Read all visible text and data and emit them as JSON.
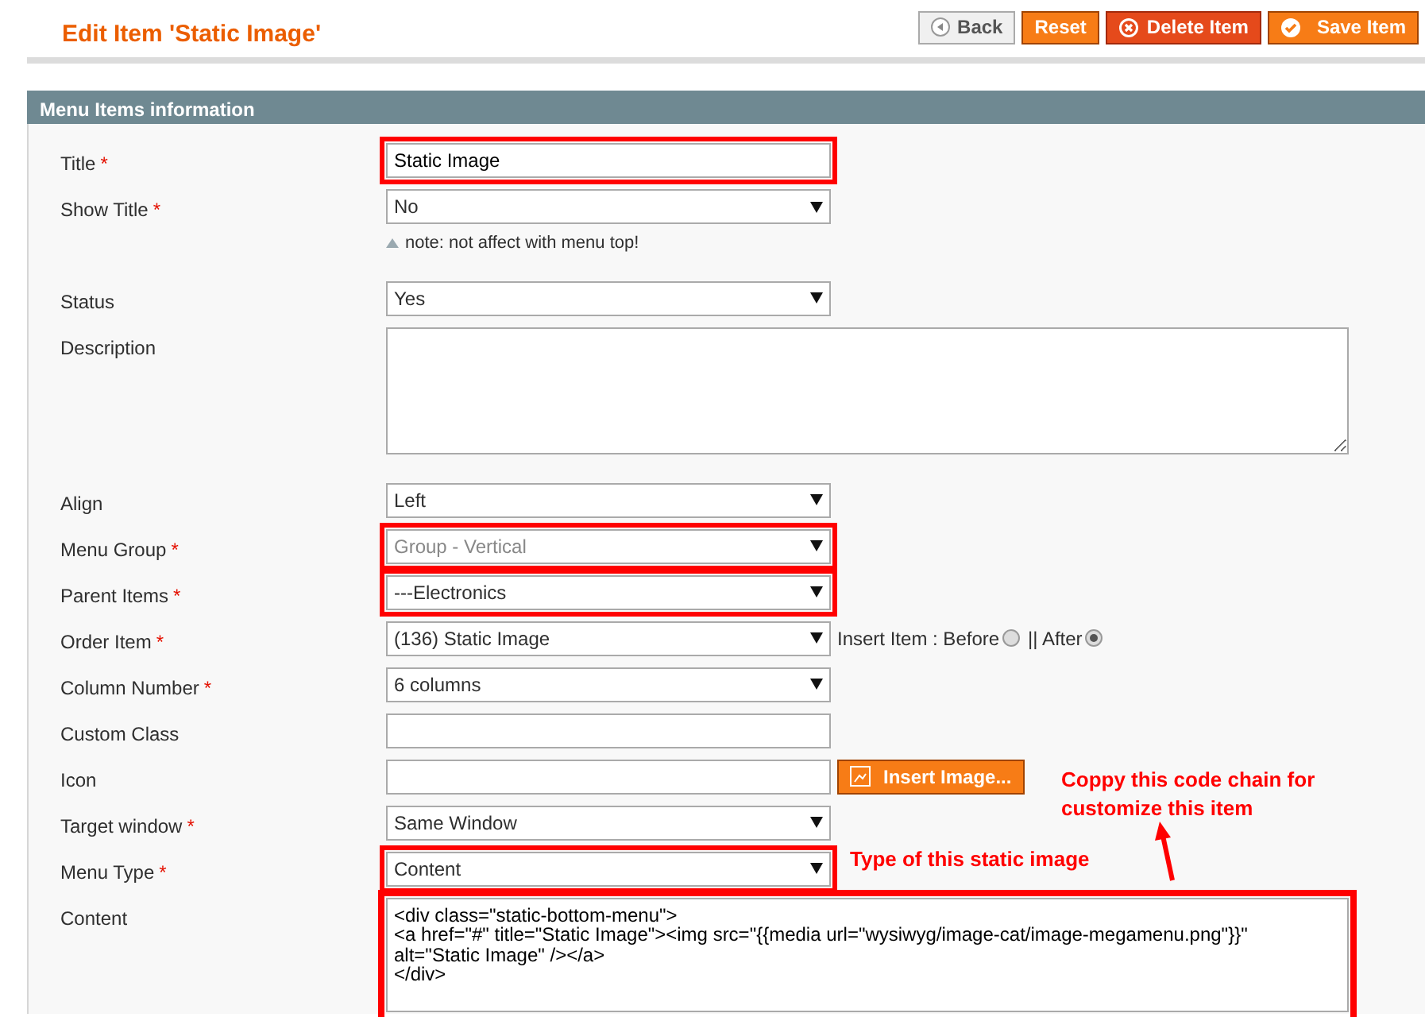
{
  "header": {
    "title": "Edit Item 'Static Image'"
  },
  "buttons": [
    {
      "label": "Back",
      "kind": "back"
    },
    {
      "label": "Reset",
      "kind": "reset"
    },
    {
      "label": "Delete Item",
      "kind": "delete"
    },
    {
      "label": "Save Item",
      "kind": "save"
    }
  ],
  "section": {
    "title": "Menu Items information"
  },
  "fields": [
    {
      "label": "Title",
      "required_mark": "*",
      "kind": "text",
      "value": "Static Image",
      "highlighted": true
    },
    {
      "label": "Show Title",
      "required_mark": "*",
      "kind": "select",
      "value": "No",
      "highlighted": false,
      "note": "note: not affect with menu top!"
    },
    {
      "label": "Status",
      "kind": "select",
      "value": "Yes",
      "highlighted": false
    },
    {
      "label": "Description",
      "kind": "textarea",
      "highlighted": false
    },
    {
      "label": "Align",
      "kind": "select",
      "value": "Left",
      "highlighted": false
    },
    {
      "label": "Menu Group",
      "required_mark": "*",
      "kind": "select",
      "value": "Group - Vertical",
      "highlighted": true,
      "disabled": true
    },
    {
      "label": "Parent Items",
      "required_mark": "*",
      "kind": "select",
      "value": "---Electronics",
      "highlighted": true
    },
    {
      "label": "Order Item",
      "required_mark": "*",
      "kind": "order",
      "value": "(136) Static Image",
      "highlighted": false,
      "radios": [
        {
          "label": "Insert Item : Before",
          "selected": false
        },
        {
          "label": "|| After",
          "selected": true
        }
      ]
    },
    {
      "label": "Column Number",
      "required_mark": "*",
      "kind": "select",
      "value": "6 columns",
      "highlighted": false
    },
    {
      "label": "Custom Class",
      "kind": "text",
      "highlighted": false
    },
    {
      "label": "Icon",
      "kind": "icon",
      "highlighted": false,
      "button": "Insert Image..."
    },
    {
      "label": "Target window",
      "required_mark": "*",
      "kind": "select",
      "value": "Same Window",
      "highlighted": false
    },
    {
      "label": "Menu Type",
      "required_mark": "*",
      "kind": "select",
      "value": "Content",
      "highlighted": true,
      "annotation": "Type of this static image"
    },
    {
      "label": "Content",
      "kind": "code",
      "highlighted": true,
      "value": "<div class=\"static-bottom-menu\">\n<a href=\"#\" title=\"Static Image\"><img src=\"{{media url=\"wysiwyg/image-cat/image-megamenu.png\"}}\" alt=\"Static Image\" /></a>\n</div>",
      "annotation": "Coppy this code chain for customize this item"
    }
  ]
}
